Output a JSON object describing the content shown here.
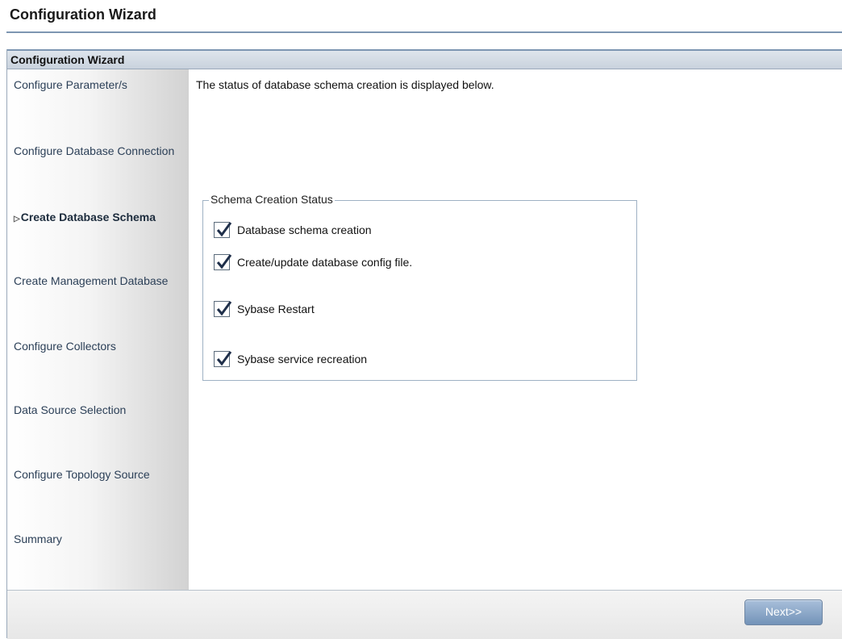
{
  "page": {
    "title": "Configuration Wizard"
  },
  "wizard": {
    "header": "Configuration Wizard",
    "steps": [
      {
        "label": "Configure Parameter/s"
      },
      {
        "label": "Configure Database Connection"
      },
      {
        "label": "Create Database Schema",
        "active": true
      },
      {
        "label": "Create Management Database"
      },
      {
        "label": "Configure Collectors"
      },
      {
        "label": "Data Source Selection"
      },
      {
        "label": "Configure Topology Source"
      },
      {
        "label": "Summary"
      }
    ],
    "active_marker": "▷"
  },
  "content": {
    "intro": "The status of database schema creation is displayed below.",
    "status_group": {
      "legend": "Schema Creation Status",
      "items": [
        {
          "label": "Database schema creation",
          "checked": true
        },
        {
          "label": "Create/update database config file.",
          "checked": true
        },
        {
          "label": "Sybase Restart",
          "checked": true
        },
        {
          "label": "Sybase service recreation",
          "checked": true
        }
      ]
    }
  },
  "footer": {
    "next_label": "Next>>"
  },
  "colors": {
    "accent": "#7d96b2",
    "button": "#7393b8"
  },
  "icons": {
    "checkbox": "checkmark-icon",
    "active_step": "triangle-right-icon"
  }
}
